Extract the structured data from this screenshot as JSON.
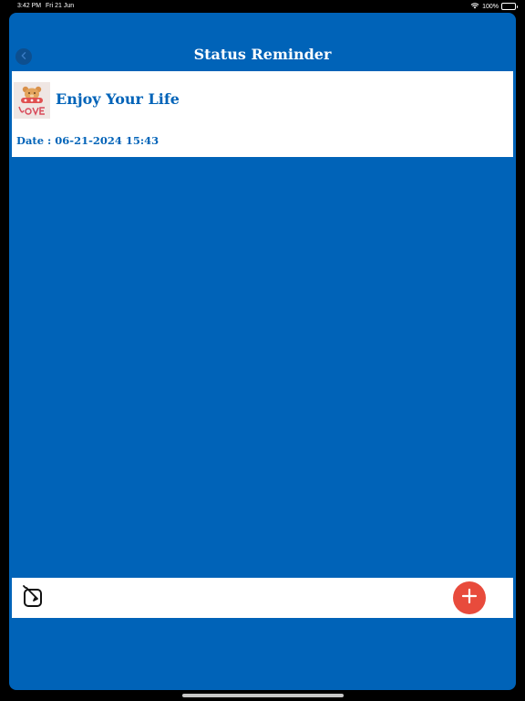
{
  "status_bar": {
    "time": "3:42 PM",
    "date": "Fri 21 Jun",
    "battery": "100%",
    "icons": [
      "wifi-icon",
      "battery-icon"
    ]
  },
  "nav": {
    "title": "Status Reminder",
    "back_icon": "chevron-left-icon"
  },
  "reminders": [
    {
      "title": "Enjoy Your Life",
      "date": "Date : 06-21-2024 15:43",
      "thumbnail": "teddy-bear-love-image"
    }
  ],
  "bottom_bar": {
    "edit_icon": "edit-square-icon",
    "add_icon": "plus-icon"
  },
  "colors": {
    "background": "#0063b8",
    "accent": "#0063b8",
    "add_button": "#e84b3c",
    "card": "#ffffff"
  }
}
